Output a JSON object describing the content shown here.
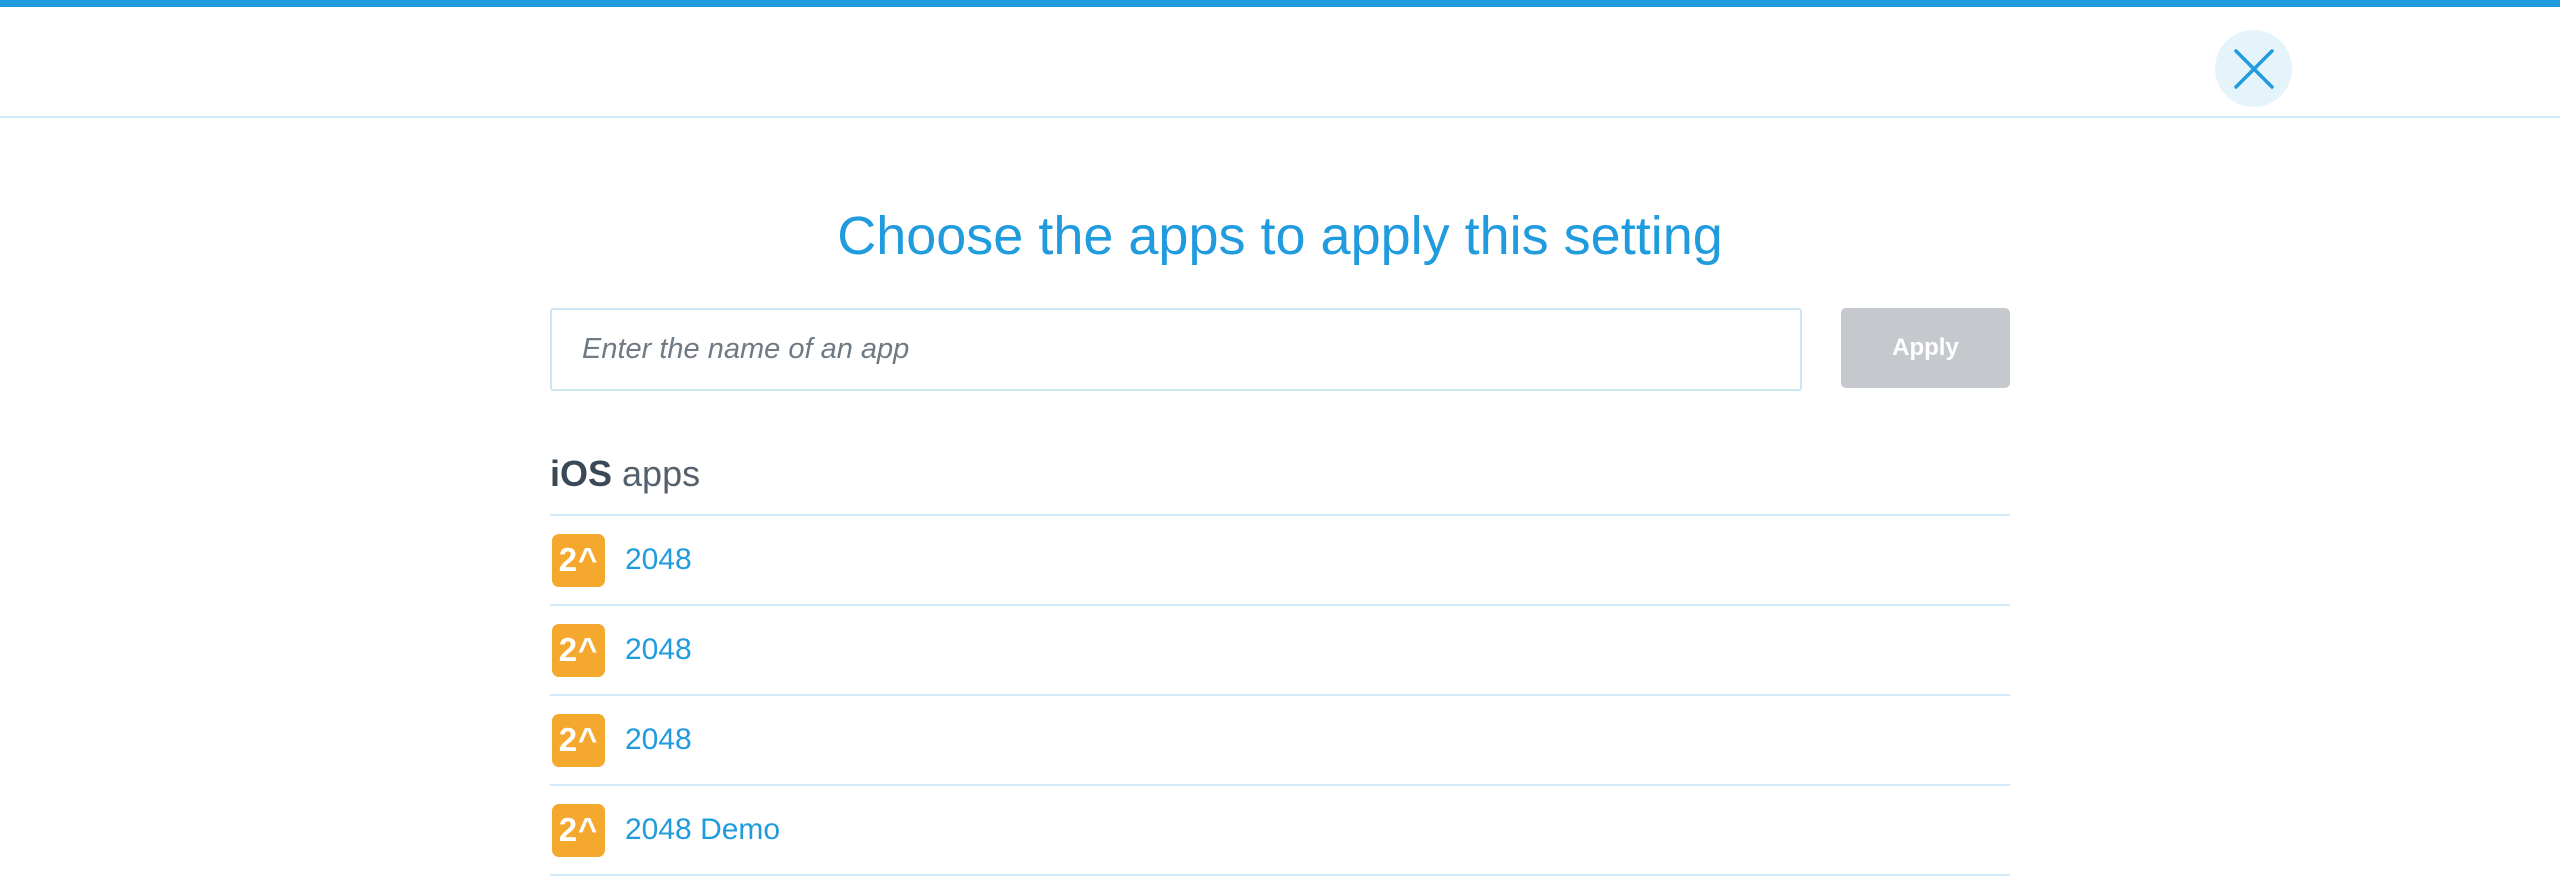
{
  "colors": {
    "accent": "#1f9bde",
    "divider": "#d4e9f6",
    "button_disabled": "#c5c9ce",
    "app_icon": "#f5a82e"
  },
  "header": {
    "close_icon": "close-icon"
  },
  "main": {
    "title": "Choose the apps to apply this setting",
    "search": {
      "placeholder": "Enter the name of an app",
      "value": ""
    },
    "apply_label": "Apply",
    "section": {
      "platform": "iOS",
      "suffix": "apps"
    },
    "apps": [
      {
        "icon_text": "2^",
        "name": "2048"
      },
      {
        "icon_text": "2^",
        "name": "2048"
      },
      {
        "icon_text": "2^",
        "name": "2048"
      },
      {
        "icon_text": "2^",
        "name": "2048 Demo"
      }
    ]
  }
}
